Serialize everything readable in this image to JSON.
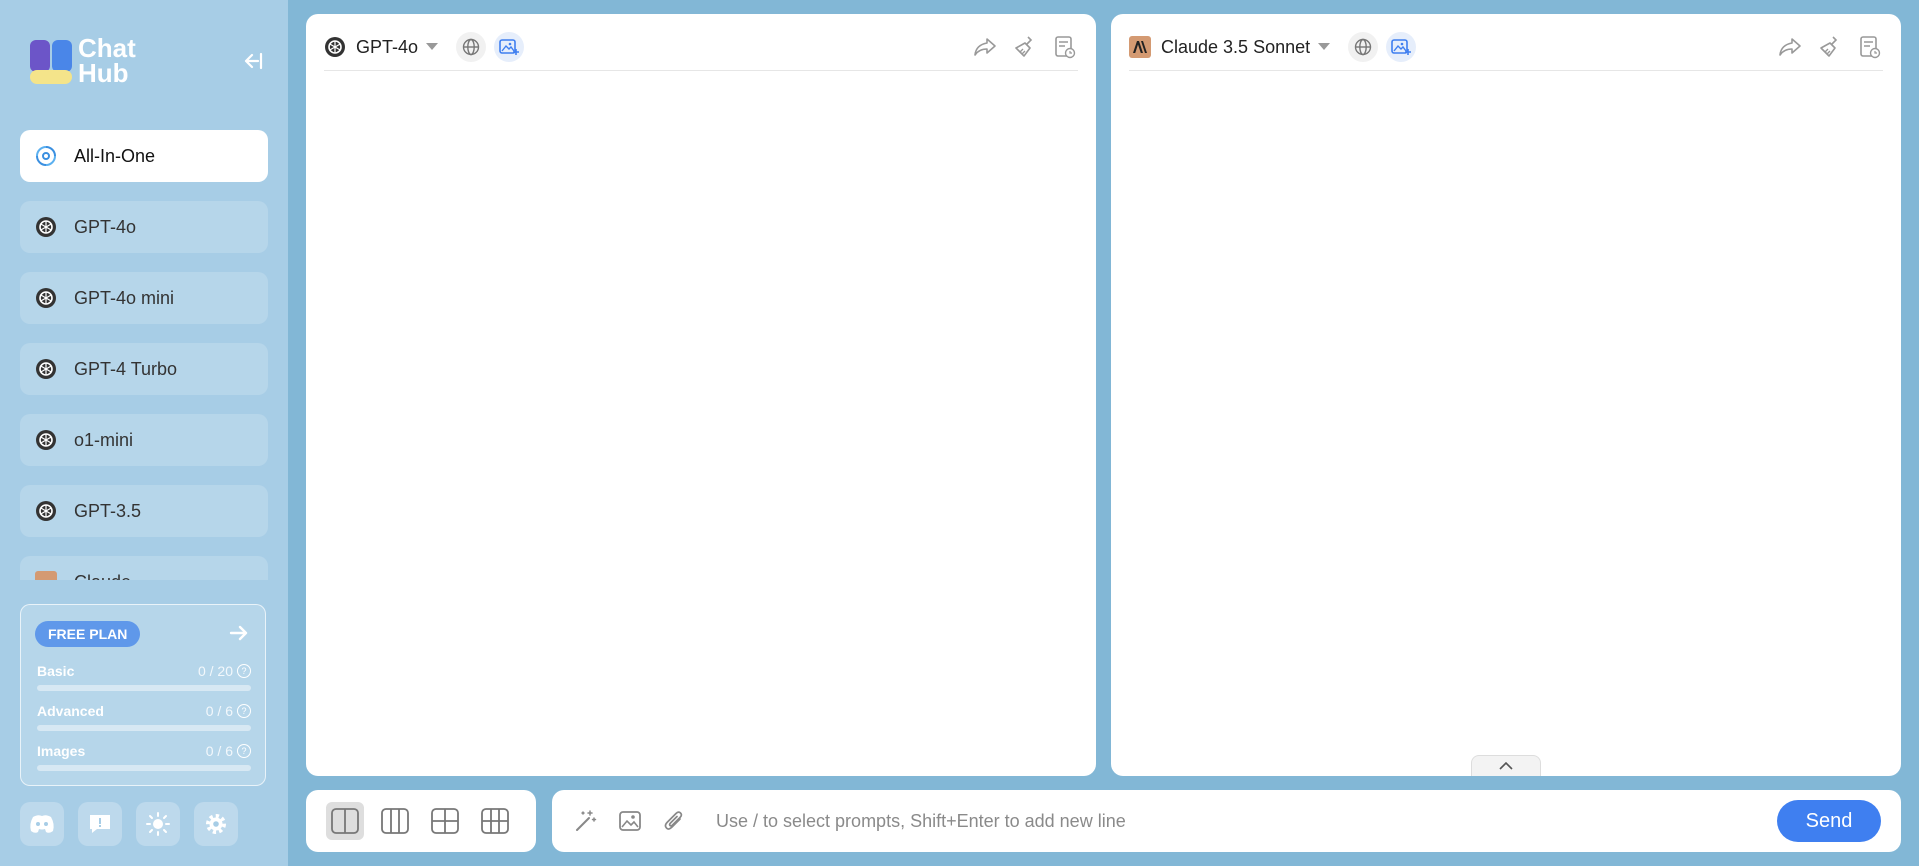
{
  "logo": {
    "line1": "Chat",
    "line2": "Hub"
  },
  "sidebar": {
    "items": [
      {
        "label": "All-In-One",
        "icon": "spiral-icon",
        "active": true
      },
      {
        "label": "GPT-4o",
        "icon": "openai-icon"
      },
      {
        "label": "GPT-4o mini",
        "icon": "openai-icon"
      },
      {
        "label": "GPT-4 Turbo",
        "icon": "openai-icon"
      },
      {
        "label": "o1-mini",
        "icon": "openai-icon"
      },
      {
        "label": "GPT-3.5",
        "icon": "openai-icon"
      },
      {
        "label": "Claude",
        "icon": "anthropic-icon"
      }
    ]
  },
  "plan": {
    "badge": "FREE PLAN",
    "usage": [
      {
        "label": "Basic",
        "count": "0 / 20",
        "fraction": 0
      },
      {
        "label": "Advanced",
        "count": "0 / 6",
        "fraction": 0
      },
      {
        "label": "Images",
        "count": "0 / 6",
        "fraction": 0
      }
    ]
  },
  "panels": [
    {
      "model": "GPT-4o",
      "icon": "openai-icon"
    },
    {
      "model": "Claude 3.5 Sonnet",
      "icon": "anthropic-icon"
    }
  ],
  "input": {
    "placeholder": "Use / to select prompts, Shift+Enter to add new line",
    "send_label": "Send"
  },
  "colors": {
    "background": "#82b7d6",
    "sidebar": "#a7cde6",
    "accent": "#3f7ff0",
    "anthropic": "#d49a72"
  }
}
